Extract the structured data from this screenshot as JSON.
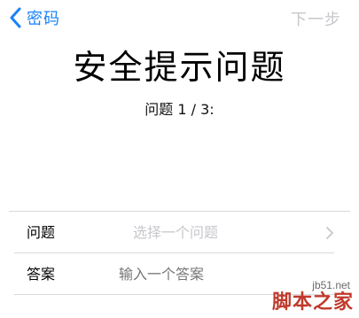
{
  "nav": {
    "back_label": "密码",
    "next_label": "下一步"
  },
  "header": {
    "title": "安全提示问题",
    "subtitle": "问题 1 / 3:"
  },
  "form": {
    "question": {
      "label": "问题",
      "placeholder": "选择一个问题"
    },
    "answer": {
      "label": "答案",
      "placeholder": "输入一个答案"
    }
  },
  "watermark": {
    "domain": "jb51.net",
    "name": "脚本之家"
  },
  "colors": {
    "accent": "#1a82fb",
    "disabled": "#c7c7cc",
    "separator": "#d8d8dc",
    "watermark": "#c0392b"
  },
  "icons": {
    "back": "chevron-left-icon",
    "disclosure": "chevron-right-icon"
  }
}
